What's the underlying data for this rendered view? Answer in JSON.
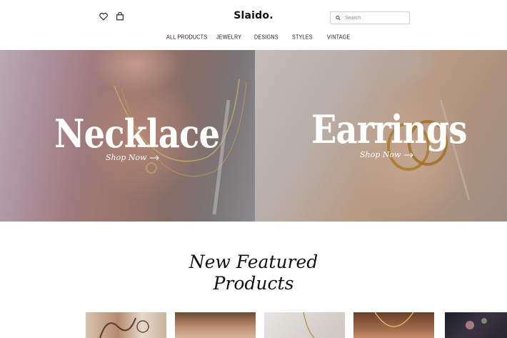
{
  "header": {
    "logo": "Slaido.",
    "wishlist_icon": "heart-icon",
    "cart_icon": "shopping-bag-icon",
    "search": {
      "placeholder": "Search",
      "icon": "search-icon"
    }
  },
  "nav": {
    "items": [
      {
        "label": "ALL PRODUCTS"
      },
      {
        "label": "JEWELRY"
      },
      {
        "label": "DESIGNS"
      },
      {
        "label": "STYLES"
      },
      {
        "label": "VINTAGE"
      }
    ]
  },
  "hero": {
    "panels": [
      {
        "title": "Necklace",
        "cta": "Shop Now",
        "cta_icon": "arrow-right-icon"
      },
      {
        "title": "Earrings",
        "cta": "Shop Now",
        "cta_icon": "arrow-right-icon"
      }
    ]
  },
  "featured": {
    "title_line1": "New Featured",
    "title_line2": "Products",
    "thumbnails": [
      {
        "name": "product-thumb-1"
      },
      {
        "name": "product-thumb-2"
      },
      {
        "name": "product-thumb-3"
      },
      {
        "name": "product-thumb-4"
      },
      {
        "name": "product-thumb-5"
      }
    ]
  },
  "colors": {
    "background": "#ffffff",
    "text": "#111111",
    "hero_text": "#ffffff",
    "border": "#cfcfcf"
  }
}
